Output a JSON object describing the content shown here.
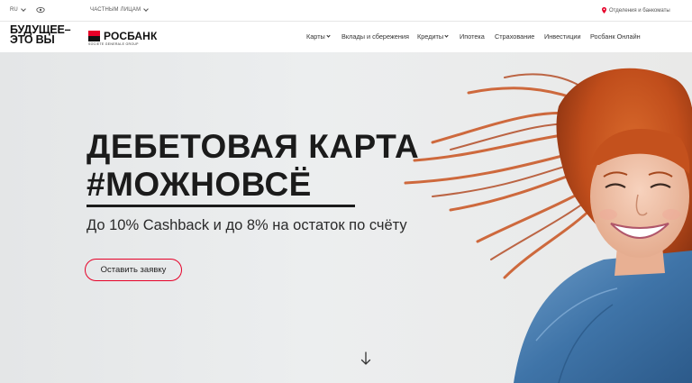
{
  "topbar": {
    "lang": "RU",
    "audience": "ЧАСТНЫМ ЛИЦАМ",
    "offices": "Отделения и банкоматы"
  },
  "header": {
    "slogan_line1": "БУДУЩЕЕ–",
    "slogan_line2": "ЭТО ВЫ",
    "brand_name": "РОСБАНК",
    "brand_sub": "SOCIETE GENERALE GROUP",
    "nav": [
      {
        "label": "Карты",
        "dropdown": true
      },
      {
        "label": "Вклады и сбережения",
        "dropdown": false
      },
      {
        "label": "Кредиты",
        "dropdown": true
      },
      {
        "label": "Ипотека",
        "dropdown": false
      },
      {
        "label": "Страхование",
        "dropdown": false
      },
      {
        "label": "Инвестиции",
        "dropdown": false
      },
      {
        "label": "Росбанк Онлайн",
        "dropdown": false
      }
    ]
  },
  "hero": {
    "headline_line1": "ДЕБЕТОВАЯ КАРТА",
    "headline_line2": "#МОЖНОВСЁ",
    "subline": "До 10% Cashback и до 8% на остаток по счёту",
    "cta_label": "Оставить заявку"
  },
  "colors": {
    "accent": "#e60028",
    "text": "#1b1b1b",
    "hair": "#c9531f",
    "denim": "#4a7fb0"
  },
  "icons": [
    "eye-icon",
    "location-pin-icon",
    "chevron-down-icon",
    "arrow-down-icon"
  ]
}
